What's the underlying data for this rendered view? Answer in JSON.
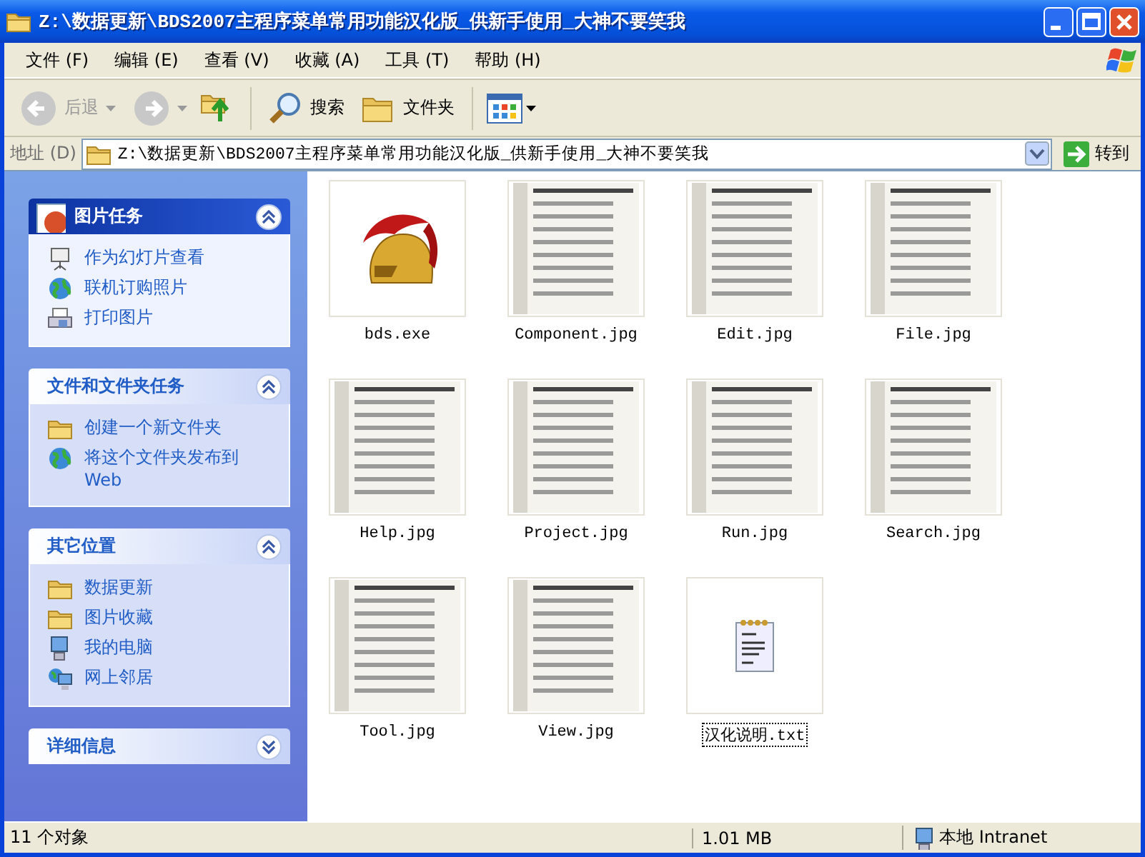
{
  "window": {
    "title": "Z:\\数据更新\\BDS2007主程序菜单常用功能汉化版_供新手使用_大神不要笑我"
  },
  "menu": [
    {
      "label": "文件",
      "key": "(F)"
    },
    {
      "label": "编辑",
      "key": "(E)"
    },
    {
      "label": "查看",
      "key": "(V)"
    },
    {
      "label": "收藏",
      "key": "(A)"
    },
    {
      "label": "工具",
      "key": "(T)"
    },
    {
      "label": "帮助",
      "key": "(H)"
    }
  ],
  "toolbar": {
    "back": {
      "label": "后退",
      "disabled": true
    },
    "search": "搜索",
    "folders": "文件夹"
  },
  "address": {
    "label": "地址",
    "key": "(D)",
    "value": "Z:\\数据更新\\BDS2007主程序菜单常用功能汉化版_供新手使用_大神不要笑我",
    "go": "转到"
  },
  "sidebar": [
    {
      "title": "图片任务",
      "kind": "special",
      "expanded": true,
      "items": [
        {
          "label": "作为幻灯片查看",
          "kind": "projector"
        },
        {
          "label": "联机订购照片",
          "kind": "globe"
        },
        {
          "label": "打印图片",
          "kind": "printer"
        }
      ]
    },
    {
      "title": "文件和文件夹任务",
      "kind": "normal",
      "expanded": true,
      "items": [
        {
          "label": "创建一个新文件夹",
          "kind": "folder"
        },
        {
          "label": "将这个文件夹发布到 Web",
          "kind": "globe"
        }
      ]
    },
    {
      "title": "其它位置",
      "kind": "normal",
      "expanded": true,
      "items": [
        {
          "label": "数据更新",
          "kind": "folder"
        },
        {
          "label": "图片收藏",
          "kind": "folder"
        },
        {
          "label": "我的电脑",
          "kind": "computer"
        },
        {
          "label": "网上邻居",
          "kind": "network"
        }
      ]
    },
    {
      "title": "详细信息",
      "kind": "normal",
      "expanded": false
    }
  ],
  "files": [
    {
      "name": "bds.exe",
      "kind": "exe",
      "selected": false
    },
    {
      "name": "Component.jpg",
      "kind": "image",
      "selected": false
    },
    {
      "name": "Edit.jpg",
      "kind": "image",
      "selected": false
    },
    {
      "name": "File.jpg",
      "kind": "image",
      "selected": false
    },
    {
      "name": "Help.jpg",
      "kind": "image",
      "selected": false
    },
    {
      "name": "Project.jpg",
      "kind": "image",
      "selected": false
    },
    {
      "name": "Run.jpg",
      "kind": "image",
      "selected": false
    },
    {
      "name": "Search.jpg",
      "kind": "image",
      "selected": false
    },
    {
      "name": "Tool.jpg",
      "kind": "image",
      "selected": false
    },
    {
      "name": "View.jpg",
      "kind": "image",
      "selected": false
    },
    {
      "name": "汉化说明.txt",
      "kind": "text",
      "selected": true
    }
  ],
  "status_bar": {
    "count": "11 个对象",
    "size": "1.01 MB",
    "zone": "本地 Intranet"
  }
}
